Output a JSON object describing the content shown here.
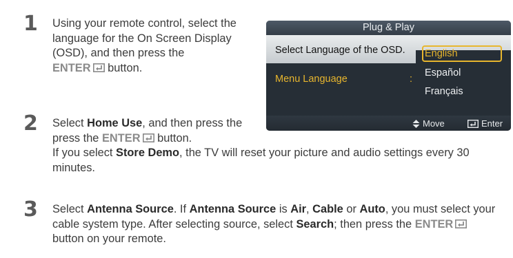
{
  "steps": [
    {
      "number": "1",
      "text_a": "Using your remote control, select the language for the On Screen Display (OSD), and then press the",
      "enter_label": "ENTER",
      "text_b": "button."
    },
    {
      "number": "2",
      "select_word": "Select",
      "home_use": "Home Use",
      "and_then": ", and then press the",
      "enter_label": "ENTER",
      "button_word": "button.",
      "if_select": "If you select",
      "store_demo": "Store Demo",
      "store_demo_rest": ", the TV will reset your picture and audio settings every 30 minutes."
    },
    {
      "number": "3",
      "select_word": "Select",
      "antenna_source": "Antenna Source",
      "if_word": ". If",
      "antenna_source_2": "Antenna Source",
      "is_word": "is",
      "air": "Air",
      "cable": "Cable",
      "or_word": "or",
      "auto": "Auto",
      "must_text": ", you must select your cable system type. After selecting source, select",
      "search": "Search",
      "then_press": "; then press the",
      "enter_label": "ENTER",
      "button_remote": "button on your remote."
    }
  ],
  "osd": {
    "title": "Plug & Play",
    "question": "Select Language of the OSD.",
    "menu_label": "Menu Language",
    "colon": ":",
    "options": [
      "English",
      "Español",
      "Français"
    ],
    "selected_index": 0,
    "footer_move": "Move",
    "footer_enter": "Enter"
  },
  "colors": {
    "accent": "#e8b62e",
    "osd_bg": "#262e36",
    "highlight_text": "#8a8a8a"
  },
  "icons": [
    "enter-icon",
    "updown-arrow-icon"
  ]
}
